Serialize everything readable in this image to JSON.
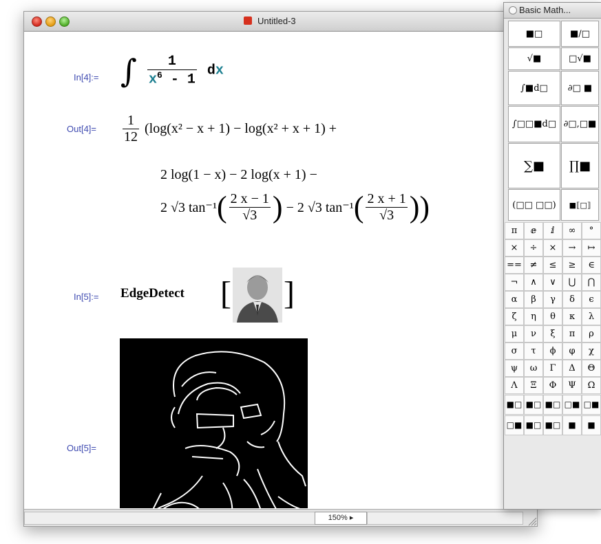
{
  "window": {
    "title": "Untitled-3",
    "zoom": "150% ▸"
  },
  "notebook": {
    "in4_label": "In[4]:=",
    "in4_integral": "∫",
    "in4_num": "1",
    "in4_x": "x",
    "in4_exp": "6",
    "in4_minus": " - 1",
    "in4_d": "d",
    "in4_dx": "x",
    "out4_label": "Out[4]=",
    "out4_frac_num": "1",
    "out4_frac_den": "12",
    "out4_line1": "(log(x² − x + 1) − log(x² + x + 1) +",
    "out4_line2": "2 log(1 − x) − 2 log(x + 1) −",
    "out4_line3_a": "2 √3 tan⁻¹",
    "out4_line3_num1": "2 x − 1",
    "out4_line3_den1": "√3",
    "out4_line3_b": "− 2 √3 tan⁻¹",
    "out4_line3_num2": "2 x + 1",
    "out4_line3_den2": "√3",
    "in5_label": "In[5]:=",
    "in5_func": "EdgeDetect",
    "out5_label": "Out[5]="
  },
  "palette": {
    "title": "Basic Math...",
    "templates": [
      "■□",
      "■/□",
      "√■",
      "□√■",
      "∫■d□",
      "∂□ ■",
      "∫□□■d□",
      "∂□,□■",
      "∑■",
      "∏■",
      "(□□ □□)",
      "■⟦□⟧"
    ],
    "symbols": [
      "π",
      "ⅇ",
      "ⅈ",
      "∞",
      "°",
      "×",
      "÷",
      "×",
      "→",
      "↦",
      "==",
      "≠",
      "≤",
      "≥",
      "∈",
      "¬",
      "∧",
      "∨",
      "⋃",
      "⋂",
      "α",
      "β",
      "γ",
      "δ",
      "ϵ",
      "ζ",
      "η",
      "θ",
      "κ",
      "λ",
      "μ",
      "ν",
      "ξ",
      "π",
      "ρ",
      "σ",
      "τ",
      "ϕ",
      "φ",
      "χ",
      "ψ",
      "ω",
      "Γ",
      "Δ",
      "Θ",
      "Λ",
      "Ξ",
      "Φ",
      "Ψ",
      "Ω"
    ],
    "box_templates": [
      "■□",
      "■□",
      "■□",
      "□■",
      "□■",
      "□■",
      "■□",
      "■□",
      "■",
      "■"
    ]
  }
}
